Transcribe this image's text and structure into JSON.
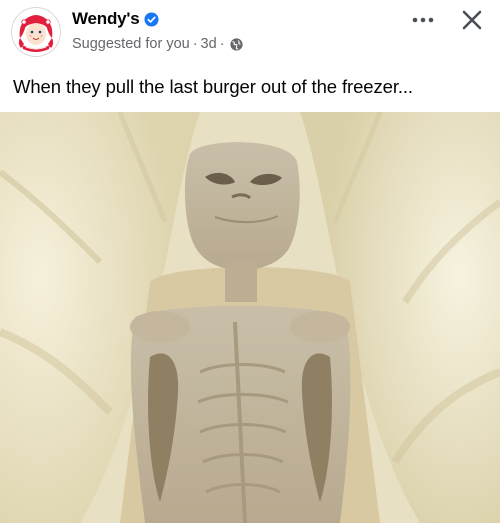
{
  "post": {
    "page_name": "Wendy's",
    "meta": {
      "suggested": "Suggested for you",
      "separator": "·",
      "age": "3d",
      "separator2": "·"
    },
    "caption": "When they pull the last burger out of the freezer...",
    "icons": {
      "avatar": "wendys-logo",
      "verified": "verified-badge-icon",
      "privacy": "globe-icon",
      "more": "more-options-icon",
      "close": "close-icon"
    },
    "colors": {
      "verified_blue": "#1877f2",
      "wendys_red": "#e2203d",
      "meta_gray": "#65676b"
    }
  }
}
